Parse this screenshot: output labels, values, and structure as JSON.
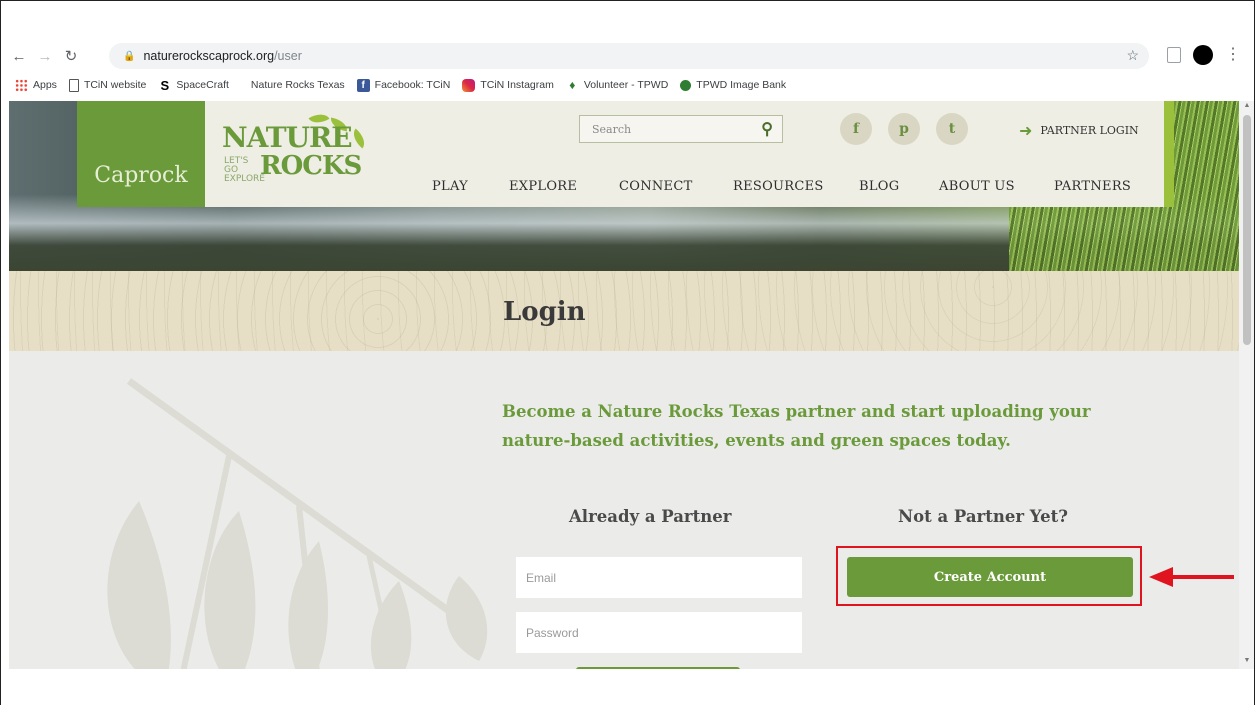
{
  "browser": {
    "url_host": "naturerockscaprock.org",
    "url_path": "/user",
    "bookmarks": [
      {
        "label": "Apps",
        "icon": "apps-grid-icon"
      },
      {
        "label": "TCiN website",
        "icon": "document-icon"
      },
      {
        "label": "SpaceCraft",
        "icon": "spacecraft-s-icon"
      },
      {
        "label": "Nature Rocks Texas",
        "icon": ""
      },
      {
        "label": "Facebook: TCiN",
        "icon": "facebook-icon"
      },
      {
        "label": "TCiN Instagram",
        "icon": "instagram-icon"
      },
      {
        "label": "Volunteer - TPWD",
        "icon": "texas-icon"
      },
      {
        "label": "TPWD Image Bank",
        "icon": "tpwd-icon"
      }
    ]
  },
  "header": {
    "site_label": "Caprock",
    "logo": {
      "line1": "NATURE",
      "line2": "LET'S GO EXPLORE",
      "line3": "ROCKS"
    },
    "search_placeholder": "Search",
    "social": [
      "f",
      "p",
      "t"
    ],
    "partner_login": "PARTNER LOGIN",
    "nav": [
      "PLAY",
      "EXPLORE",
      "CONNECT",
      "RESOURCES",
      "BLOG",
      "ABOUT US",
      "PARTNERS"
    ]
  },
  "page": {
    "title": "Login",
    "intro": "Become a Nature Rocks Texas partner and start uploading your nature-based activities, events and green spaces today.",
    "already_partner": {
      "heading": "Already a Partner",
      "email_placeholder": "Email",
      "password_placeholder": "Password"
    },
    "not_partner": {
      "heading": "Not a Partner Yet?",
      "create_label": "Create Account"
    }
  },
  "colors": {
    "brand_green": "#6a9a3a",
    "lime_accent": "#9bc13c",
    "annotation_red": "#e0141e"
  }
}
